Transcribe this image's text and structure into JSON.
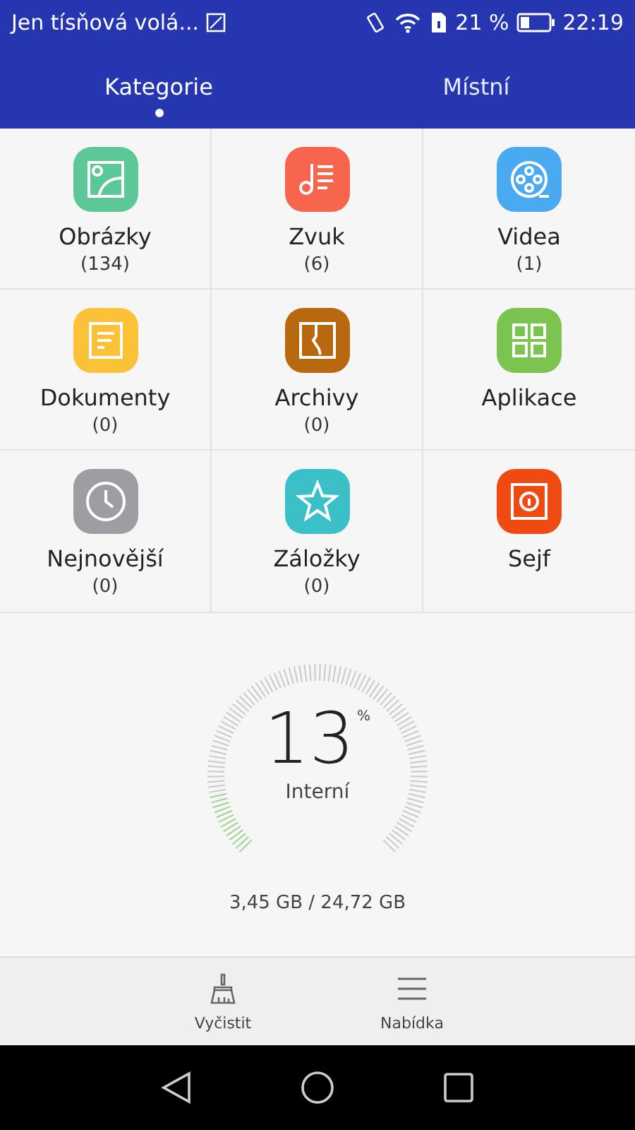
{
  "status_bar": {
    "notification": "Jen tísňová volá...",
    "battery": "21 %",
    "time": "22:19"
  },
  "tabs": [
    {
      "label": "Kategorie",
      "selected": true
    },
    {
      "label": "Místní",
      "selected": false
    }
  ],
  "categories": [
    {
      "kind": "images",
      "name": "Obrázky",
      "count": "(134)",
      "color": "#5cc898"
    },
    {
      "kind": "audio",
      "name": "Zvuk",
      "count": "(6)",
      "color": "#f7654f"
    },
    {
      "kind": "video",
      "name": "Videa",
      "count": "(1)",
      "color": "#4aaaf0"
    },
    {
      "kind": "documents",
      "name": "Dokumenty",
      "count": "(0)",
      "color": "#fcc237"
    },
    {
      "kind": "archives",
      "name": "Archivy",
      "count": "(0)",
      "color": "#b8680f"
    },
    {
      "kind": "apps",
      "name": "Aplikace",
      "color": "#7cc450"
    },
    {
      "kind": "recent",
      "name": "Nejnovější",
      "count": "(0)",
      "color": "#9c9ea2"
    },
    {
      "kind": "favorites",
      "name": "Záložky",
      "count": "(0)",
      "color": "#3cc0c8"
    },
    {
      "kind": "safe",
      "name": "Sejf",
      "color": "#ef4a12"
    }
  ],
  "storage": {
    "percent": "13",
    "unit": "%",
    "label": "Interní",
    "usage": "3,45 GB / 24,72 GB"
  },
  "bottom_actions": [
    {
      "kind": "clean",
      "label": "Vyčistit"
    },
    {
      "kind": "menu",
      "label": "Nabídka"
    }
  ]
}
